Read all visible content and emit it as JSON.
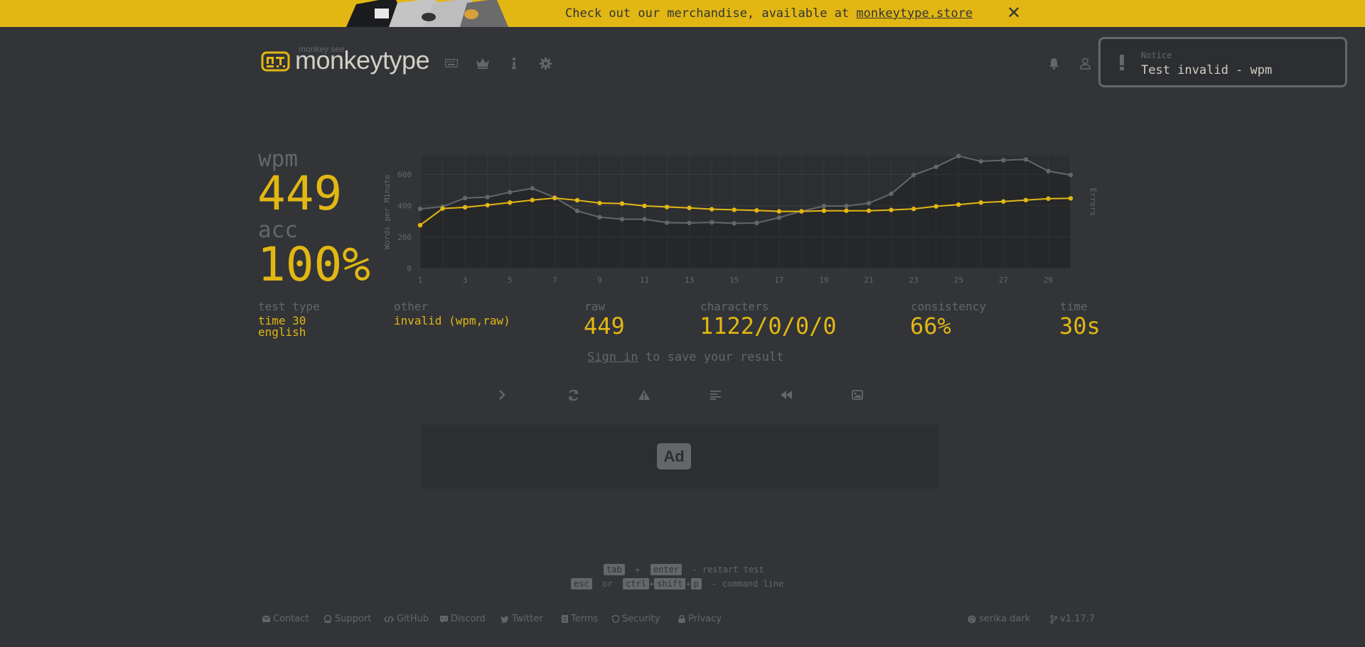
{
  "banner": {
    "text": "Check out our merchandise, available at ",
    "link": "monkeytype.store",
    "close_icon": "close-icon"
  },
  "header": {
    "logo_small": "monkey see",
    "logo_text": "monkeytype",
    "nav_icons": [
      "keyboard-icon",
      "crown-icon",
      "info-icon",
      "gear-icon"
    ],
    "right_icons": [
      "bell-icon",
      "user-icon"
    ]
  },
  "notice": {
    "title": "Notice",
    "text": "Test invalid - wpm",
    "icon": "exclamation-icon"
  },
  "result": {
    "wpm_label": "wpm",
    "wpm_value": "449",
    "acc_label": "acc",
    "acc_value": "100%"
  },
  "stats": {
    "test_type_label": "test type",
    "test_type_line1": "time 30",
    "test_type_line2": "english",
    "other_label": "other",
    "other_value": "invalid (wpm,raw)",
    "raw_label": "raw",
    "raw_value": "449",
    "characters_label": "characters",
    "characters_value": "1122/0/0/0",
    "consistency_label": "consistency",
    "consistency_value": "66%",
    "time_label": "time",
    "time_value": "30s"
  },
  "signin": {
    "link": "Sign in",
    "text": " to save your result"
  },
  "actions": [
    "next-test-icon",
    "restart-icon",
    "warning-icon",
    "words-history-icon",
    "replay-icon",
    "screenshot-icon"
  ],
  "ad": {
    "label": "Ad"
  },
  "shortcuts": {
    "line1_keys": [
      "tab",
      "enter"
    ],
    "line1_plus": "+",
    "line1_text": "- restart test",
    "line2_keys": [
      "esc",
      "ctrl",
      "shift",
      "p"
    ],
    "line2_or": "or",
    "line2_plus": "+",
    "line2_text": "- command line"
  },
  "footer": {
    "links": [
      "Contact",
      "Support",
      "GitHub",
      "Discord",
      "Twitter",
      "Terms",
      "Security",
      "Privacy"
    ],
    "theme": "serika dark",
    "version": "v1.17.7"
  },
  "colors": {
    "background": "#323437",
    "accent": "#e2b714",
    "sub": "#646669",
    "text": "#d1d0c5",
    "sub_alt": "#2c2e31"
  },
  "chart_data": {
    "type": "line",
    "x": [
      1,
      2,
      3,
      4,
      5,
      6,
      7,
      8,
      9,
      10,
      11,
      12,
      13,
      14,
      15,
      16,
      17,
      18,
      19,
      20,
      21,
      22,
      23,
      24,
      25,
      26,
      27,
      28,
      29,
      30
    ],
    "xticks": [
      "1",
      "3",
      "5",
      "7",
      "9",
      "11",
      "13",
      "15",
      "17",
      "19",
      "21",
      "23",
      "25",
      "27",
      "29"
    ],
    "yticks": [
      "0",
      "200",
      "400",
      "600"
    ],
    "ylim": [
      0,
      720
    ],
    "ylabel": "Words per Minute",
    "y2label": "Errors",
    "grid": true,
    "series": [
      {
        "name": "wpm",
        "color": "#e2b714",
        "values": [
          276,
          382,
          390,
          404,
          420,
          436,
          449,
          435,
          417,
          414,
          399,
          392,
          386,
          378,
          374,
          370,
          364,
          364,
          368,
          368,
          368,
          373,
          380,
          396,
          407,
          420,
          427,
          436,
          445,
          447
        ]
      },
      {
        "name": "raw",
        "color": "#646669",
        "values": [
          380,
          394,
          449,
          455,
          486,
          511,
          453,
          367,
          327,
          314,
          314,
          292,
          290,
          294,
          288,
          290,
          324,
          365,
          398,
          398,
          416,
          476,
          596,
          648,
          717,
          683,
          690,
          695,
          621,
          596
        ]
      }
    ]
  }
}
